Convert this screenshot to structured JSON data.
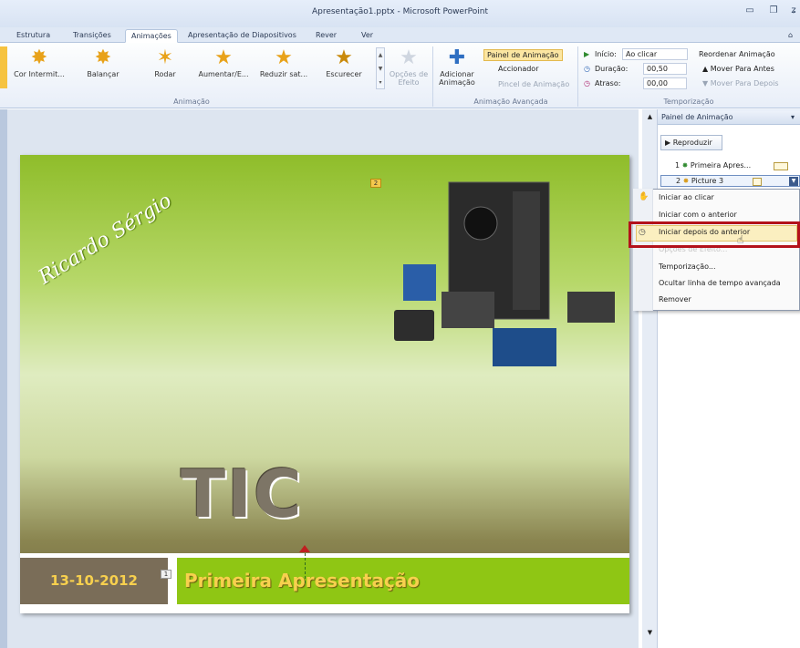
{
  "window": {
    "title": "Apresentação1.pptx - Microsoft PowerPoint"
  },
  "tabs": [
    {
      "label": "Estrutura"
    },
    {
      "label": "Transições"
    },
    {
      "label": "Animações",
      "active": true
    },
    {
      "label": "Apresentação de Diapositivos"
    },
    {
      "label": "Rever"
    },
    {
      "label": "Ver"
    }
  ],
  "ribbon": {
    "effects": [
      {
        "label": "Cor Intermit..."
      },
      {
        "label": "Balançar"
      },
      {
        "label": "Rodar"
      },
      {
        "label": "Aumentar/E..."
      },
      {
        "label": "Reduzir sat..."
      },
      {
        "label": "Escurecer"
      }
    ],
    "effect_options": "Opções de Efeito",
    "group_animation": "Animação",
    "add_animation": "Adicionar Animação",
    "animation_pane": "Painel de Animação",
    "trigger": "Accionador",
    "painter": "Pincel de Animação",
    "group_advanced": "Animação Avançada",
    "start_label": "Início:",
    "start_value": "Ao clicar",
    "duration_label": "Duração:",
    "duration_value": "00,50",
    "delay_label": "Atraso:",
    "delay_value": "00,00",
    "reorder": "Reordenar Animação",
    "move_earlier": "Mover Para Antes",
    "move_later": "Mover Para Depois",
    "group_timing": "Temporização"
  },
  "slide": {
    "signature": "Ricardo Sérgio",
    "heading": "TIC",
    "date": "13-10-2012",
    "title": "Primeira Apresentação",
    "marker_2": "2",
    "marker_1": "1"
  },
  "pane": {
    "title": "Painel de Animação",
    "play": "Reproduzir",
    "items": [
      {
        "num": "1",
        "label": "Primeira Apres..."
      },
      {
        "num": "2",
        "label": "Picture 3"
      }
    ]
  },
  "menu": {
    "items": [
      "Iniciar ao clicar",
      "Iniciar com o anterior",
      "Iniciar depois do anterior",
      "Opções de Efeito...",
      "Temporização...",
      "Ocultar linha de tempo avançada",
      "Remover"
    ]
  },
  "colors": {
    "highlight_border": "#b3121b",
    "date_box": "#7a6d58",
    "title_box": "#8fc614",
    "slide_text": "#f7d04e"
  }
}
